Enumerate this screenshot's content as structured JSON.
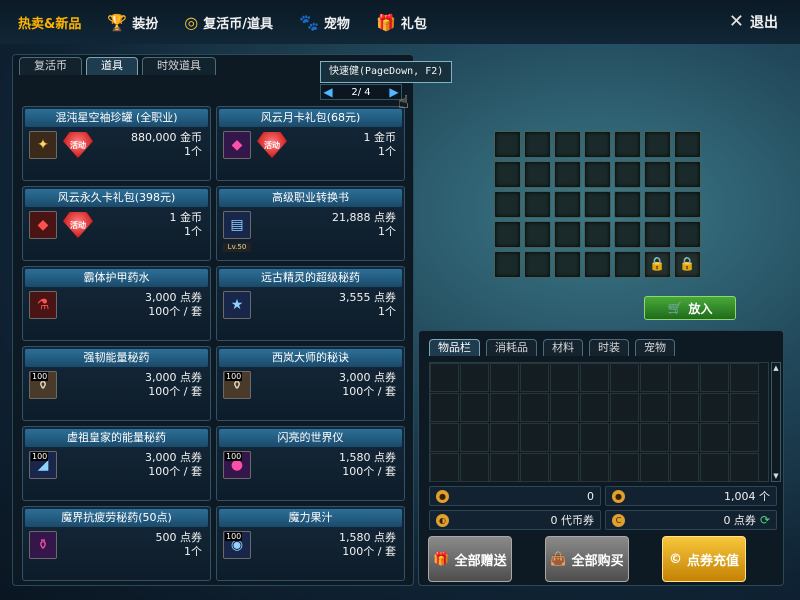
{
  "topbar": {
    "tabs": [
      {
        "label": "热卖&新品",
        "icon": "hot-new-icon"
      },
      {
        "label": "装扮",
        "icon": "trophy-icon"
      },
      {
        "label": "复活币/道具",
        "icon": "coin-icon"
      },
      {
        "label": "宠物",
        "icon": "paw-icon"
      },
      {
        "label": "礼包",
        "icon": "gift-icon"
      }
    ],
    "exit_label": "退出"
  },
  "subtabs": [
    {
      "label": "复活币",
      "active": false
    },
    {
      "label": "道具",
      "active": true
    },
    {
      "label": "时效道具",
      "active": false
    }
  ],
  "tooltip": "快速健(PageDown, F2)",
  "pager": {
    "text": "2/ 4"
  },
  "items": [
    {
      "name": "混沌星空袖珍罐 (全职业)",
      "icon": "jar-icon",
      "badge": "活动",
      "price": "880,000 金币",
      "qty": "1个"
    },
    {
      "name": "风云月卡礼包(68元)",
      "icon": "giftbox-icon",
      "badge": "活动",
      "price": "1 金币",
      "qty": "1个"
    },
    {
      "name": "风云永久卡礼包(398元)",
      "icon": "giftbox-icon",
      "badge": "活动",
      "price": "1 金币",
      "qty": "1个"
    },
    {
      "name": "高级职业转换书",
      "icon": "book-icon",
      "level": "Lv.50",
      "price": "21,888 点券",
      "qty": "1个"
    },
    {
      "name": "霸体护甲药水",
      "icon": "potion-icon",
      "price": "3,000 点券",
      "qty": "100个 / 套"
    },
    {
      "name": "远古精灵的超级秘药",
      "icon": "exp-potion-icon",
      "price": "3,555 点券",
      "qty": "1个"
    },
    {
      "name": "强韧能量秘药",
      "icon": "flask-icon",
      "stack": "100",
      "price": "3,000 点券",
      "qty": "100个 / 套"
    },
    {
      "name": "西岚大师的秘诀",
      "icon": "flask-icon",
      "stack": "100",
      "price": "3,000 点券",
      "qty": "100个 / 套"
    },
    {
      "name": "虚祖皇家的能量秘药",
      "icon": "elixir-icon",
      "stack": "100",
      "price": "3,000 点券",
      "qty": "100个 / 套"
    },
    {
      "name": "闪亮的世界仪",
      "icon": "orb-icon",
      "stack": "100",
      "price": "1,580 点券",
      "qty": "100个 / 套"
    },
    {
      "name": "魔界抗疲劳秘药(50点)",
      "icon": "bottle-icon",
      "price": "500 点券",
      "qty": "1个"
    },
    {
      "name": "魔力果汁",
      "icon": "juice-icon",
      "stack": "100",
      "price": "1,580 点券",
      "qty": "100个 / 套"
    }
  ],
  "put_button": "放入",
  "inventory_tabs": [
    {
      "label": "物品栏",
      "active": true
    },
    {
      "label": "消耗品",
      "active": false
    },
    {
      "label": "材料",
      "active": false
    },
    {
      "label": "时装",
      "active": false
    },
    {
      "label": "宠物",
      "active": false
    }
  ],
  "wallet": {
    "row1_left": "0",
    "row1_right": "1,004 个",
    "row2_left": "0 代币券",
    "row2_right": "0 点券"
  },
  "buttons": {
    "gift_all": "全部赠送",
    "buy_all": "全部购买",
    "recharge": "点券充值"
  }
}
